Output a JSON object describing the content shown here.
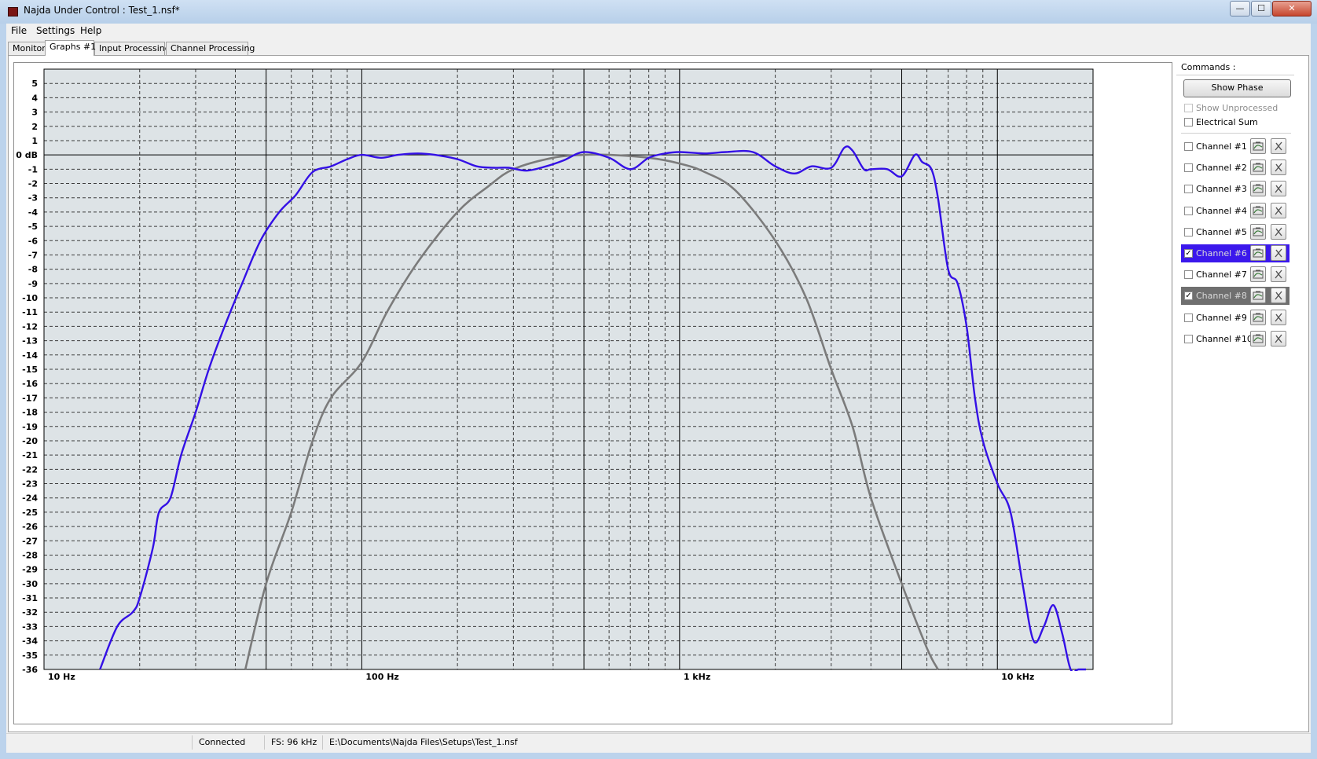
{
  "window": {
    "title": "Najda Under Control : Test_1.nsf*",
    "min_glyph": "—",
    "max_glyph": "☐",
    "close_glyph": "✕"
  },
  "menu": {
    "file": "File",
    "settings": "Settings",
    "help": "Help"
  },
  "tabs": [
    "Monitor",
    "Graphs #1",
    "Input Processing",
    "Channel Processing"
  ],
  "active_tab": 1,
  "commands": {
    "title": "Commands :",
    "show_phase": "Show Phase",
    "show_unprocessed": "Show Unprocessed",
    "electrical_sum": "Electrical Sum",
    "show_unprocessed_checked": false,
    "show_unprocessed_enabled": false,
    "electrical_sum_checked": false
  },
  "channels": [
    {
      "label": "Channel #1",
      "checked": false,
      "highlight": "none"
    },
    {
      "label": "Channel #2",
      "checked": false,
      "highlight": "none"
    },
    {
      "label": "Channel #3",
      "checked": false,
      "highlight": "none"
    },
    {
      "label": "Channel #4",
      "checked": false,
      "highlight": "none"
    },
    {
      "label": "Channel #5",
      "checked": false,
      "highlight": "none"
    },
    {
      "label": "Channel #6",
      "checked": true,
      "highlight": "blue"
    },
    {
      "label": "Channel #7",
      "checked": false,
      "highlight": "none"
    },
    {
      "label": "Channel #8",
      "checked": true,
      "highlight": "gray"
    },
    {
      "label": "Channel #9",
      "checked": false,
      "highlight": "none"
    },
    {
      "label": "Channel #10",
      "checked": false,
      "highlight": "none"
    }
  ],
  "status": {
    "connection": "Connected",
    "fs": "FS: 96 kHz",
    "path": "E:\\Documents\\Najda Files\\Setups\\Test_1.nsf"
  },
  "colors": {
    "plot_bg": "#dde3e6",
    "channel6": "#3410e6",
    "channel8": "#7b7b7b"
  },
  "chart_data": {
    "type": "line",
    "x_scale": "log",
    "xlim": [
      10,
      20000
    ],
    "ylim": [
      -36,
      6
    ],
    "x_tick_labels": [
      {
        "value": 10,
        "label": "10 Hz"
      },
      {
        "value": 100,
        "label": "100 Hz"
      },
      {
        "value": 1000,
        "label": "1 kHz"
      },
      {
        "value": 10000,
        "label": "10 kHz"
      }
    ],
    "y_ticks": [
      5,
      4,
      3,
      2,
      1,
      0,
      -1,
      -2,
      -3,
      -4,
      -5,
      -6,
      -7,
      -8,
      -9,
      -10,
      -11,
      -12,
      -13,
      -14,
      -15,
      -16,
      -17,
      -18,
      -19,
      -20,
      -21,
      -22,
      -23,
      -24,
      -25,
      -26,
      -27,
      -28,
      -29,
      -30,
      -31,
      -32,
      -33,
      -34,
      -35,
      -36
    ],
    "y_zero_label": "0 dB",
    "grid": true,
    "series": [
      {
        "color": "#3410e6",
        "x": [
          15,
          17,
          19,
          20,
          22,
          23,
          25,
          27,
          30,
          33,
          37,
          42,
          48,
          55,
          62,
          70,
          80,
          90,
          100,
          115,
          130,
          150,
          170,
          200,
          230,
          260,
          290,
          330,
          380,
          430,
          500,
          600,
          700,
          800,
          900,
          1000,
          1200,
          1400,
          1700,
          2000,
          2300,
          2600,
          3000,
          3300,
          3500,
          3800,
          4000,
          4500,
          5000,
          5500,
          5800,
          6200,
          6500,
          7000,
          7500,
          8000,
          8500,
          9000,
          10000,
          11000,
          12000,
          13000,
          14000,
          15000,
          16000,
          17000,
          18000,
          19000
        ],
        "y": [
          -36,
          -33,
          -32,
          -31,
          -27.5,
          -25,
          -24,
          -21,
          -18,
          -15,
          -12,
          -9,
          -6,
          -4,
          -2.8,
          -1.2,
          -0.8,
          -0.3,
          0.0,
          -0.2,
          0.0,
          0.1,
          0.0,
          -0.3,
          -0.8,
          -0.9,
          -0.9,
          -1.1,
          -0.8,
          -0.4,
          0.2,
          -0.2,
          -1.0,
          -0.2,
          0.1,
          0.2,
          0.1,
          0.2,
          0.2,
          -0.8,
          -1.3,
          -0.8,
          -0.9,
          0.5,
          0.3,
          -1.0,
          -1.0,
          -1.0,
          -1.5,
          0.0,
          -0.5,
          -1.0,
          -3.0,
          -8.0,
          -9.0,
          -12.0,
          -17.0,
          -20.0,
          -23.0,
          -25.0,
          -30.0,
          -34.0,
          -33.0,
          -31.5,
          -33.5,
          -36.0,
          -36.0,
          -36.0
        ]
      },
      {
        "color": "#7b7b7b",
        "x": [
          43,
          50,
          60,
          70,
          80,
          100,
          120,
          150,
          200,
          250,
          300,
          400,
          500,
          600,
          800,
          1000,
          1200,
          1500,
          2000,
          2500,
          3000,
          3500,
          4000,
          5000,
          6000,
          6500
        ],
        "y": [
          -36,
          -30,
          -25,
          -20,
          -17,
          -14.5,
          -11,
          -7.5,
          -4.0,
          -2.2,
          -1.0,
          -0.2,
          0.0,
          0.0,
          -0.2,
          -0.6,
          -1.2,
          -2.5,
          -6.0,
          -10.0,
          -15.0,
          -19.0,
          -24.0,
          -30.0,
          -34.5,
          -36.0
        ]
      }
    ]
  }
}
